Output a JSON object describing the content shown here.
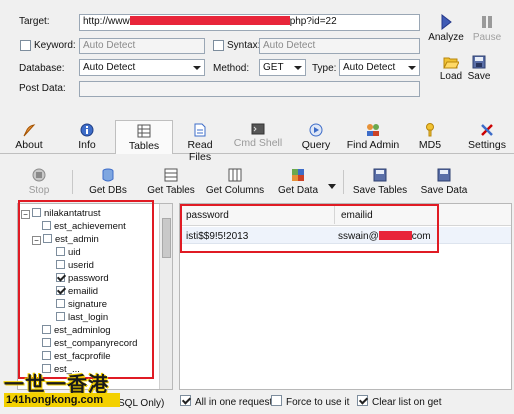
{
  "form": {
    "target_label": "Target:",
    "target_value_prefix": "http://www",
    "target_value_suffix": "php?id=22",
    "keyword_label": "Keyword:",
    "keyword_placeholder": "Auto Detect",
    "syntax_label": "Syntax:",
    "syntax_placeholder": "Auto Detect",
    "database_label": "Database:",
    "database_value": "Auto Detect",
    "method_label": "Method:",
    "method_value": "GET",
    "type_label": "Type:",
    "type_value": "Auto Detect",
    "postdata_label": "Post Data:"
  },
  "side_buttons": {
    "analyze": "Analyze",
    "pause": "Pause",
    "load": "Load",
    "save": "Save"
  },
  "tabs": [
    {
      "label": "About",
      "icon": "feather-icon"
    },
    {
      "label": "Info",
      "icon": "info-icon"
    },
    {
      "label": "Tables",
      "icon": "table-icon"
    },
    {
      "label": "Read Files",
      "icon": "file-icon"
    },
    {
      "label": "Cmd Shell",
      "icon": "console-icon"
    },
    {
      "label": "Query",
      "icon": "query-icon"
    },
    {
      "label": "Find Admin",
      "icon": "people-icon"
    },
    {
      "label": "MD5",
      "icon": "key-icon"
    },
    {
      "label": "Settings",
      "icon": "tools-icon"
    }
  ],
  "toolbar": {
    "stop": "Stop",
    "get_dbs": "Get DBs",
    "get_tables": "Get Tables",
    "get_columns": "Get Columns",
    "get_data": "Get Data",
    "save_tables": "Save Tables",
    "save_data": "Save Data"
  },
  "tree": {
    "root": "nilakantatrust",
    "nodes": [
      {
        "label": "est_achievement",
        "level": 1
      },
      {
        "label": "est_admin",
        "level": 1
      },
      {
        "label": "uid",
        "level": 2
      },
      {
        "label": "userid",
        "level": 2
      },
      {
        "label": "password",
        "level": 2
      },
      {
        "label": "emailid",
        "level": 2
      },
      {
        "label": "signature",
        "level": 2
      },
      {
        "label": "last_login",
        "level": 2
      },
      {
        "label": "est_adminlog",
        "level": 1
      },
      {
        "label": "est_companyrecord",
        "level": 1
      },
      {
        "label": "est_facprofile",
        "level": 1
      },
      {
        "label": "est_...",
        "level": 1
      }
    ]
  },
  "grid": {
    "columns": [
      "password",
      "emailid"
    ],
    "rows": [
      {
        "password": "isti$$9!5!2013",
        "emailid_prefix": "sswain@",
        "emailid_suffix": "com"
      }
    ]
  },
  "bottom": {
    "partial_note": "SQL Only)",
    "all_in_one": "All in one request.",
    "force": "Force to use it",
    "clear_list": "Clear list on get"
  },
  "watermark": {
    "line1": "一世一香港",
    "line2": "141hongkong.com"
  },
  "colors": {
    "highlight_red": "#e01b24",
    "redaction": "#e8253a",
    "window_bg": "#f0f0f0"
  }
}
